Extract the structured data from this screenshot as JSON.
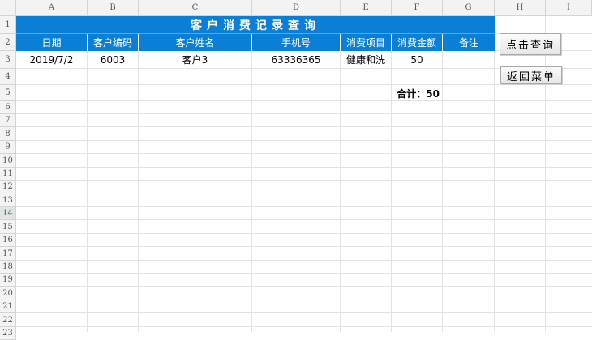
{
  "columns": [
    "A",
    "B",
    "C",
    "D",
    "E",
    "F",
    "G",
    "H",
    "I"
  ],
  "rows": [
    "1",
    "2",
    "3",
    "4",
    "5",
    "6",
    "7",
    "8",
    "9",
    "10",
    "11",
    "12",
    "13",
    "14",
    "15",
    "16",
    "17",
    "18",
    "19",
    "20",
    "21",
    "22",
    "23"
  ],
  "selected_row": "14",
  "title": "客户消费记录查询",
  "headers": [
    "日期",
    "客户编码",
    "客户姓名",
    "手机号",
    "消费项目",
    "消费金额",
    "备注"
  ],
  "record": {
    "date": "2019/7/2",
    "code": "6003",
    "name": "客户3",
    "phone": "63336365",
    "item": "健康和洗",
    "amount": "50",
    "note": ""
  },
  "total_label": "合计：50",
  "buttons": {
    "query": "点击查询",
    "back": "返回菜单"
  },
  "colors": {
    "header_blue": "#0a7fd8",
    "grid": "#e2e2e2"
  }
}
